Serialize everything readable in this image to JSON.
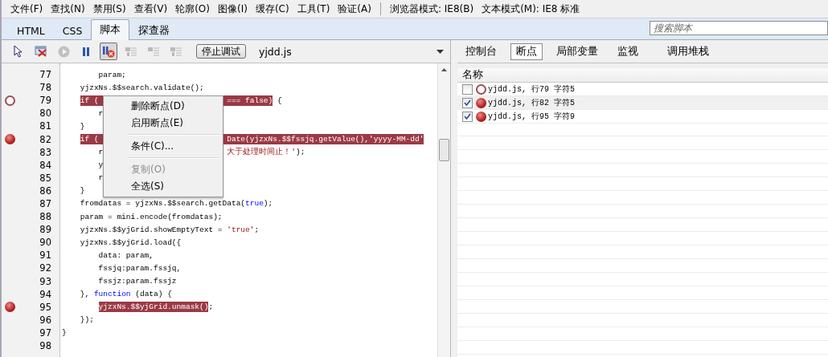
{
  "menu": [
    "文件(F)",
    "查找(N)",
    "禁用(S)",
    "查看(V)",
    "轮廓(O)",
    "图像(I)",
    "缓存(C)",
    "工具(T)",
    "验证(A)"
  ],
  "modes": [
    "浏览器模式: IE8(B)",
    "文本模式(M): IE8 标准"
  ],
  "tabs": [
    {
      "label": "HTML",
      "selected": false
    },
    {
      "label": "CSS",
      "selected": false
    },
    {
      "label": "脚本",
      "selected": true
    },
    {
      "label": "探查器",
      "selected": false
    }
  ],
  "search": {
    "placeholder": "搜索脚本"
  },
  "tools": [
    {
      "kind": "select",
      "disabled": false,
      "pressed": false
    },
    {
      "kind": "clear",
      "disabled": false,
      "pressed": false
    },
    {
      "kind": "continue",
      "disabled": true,
      "pressed": false
    },
    {
      "kind": "pause",
      "disabled": false,
      "pressed": false
    },
    {
      "kind": "break-on-error",
      "disabled": false,
      "pressed": true
    },
    {
      "kind": "step-into",
      "disabled": true,
      "pressed": false
    },
    {
      "kind": "step-over",
      "disabled": true,
      "pressed": false
    },
    {
      "kind": "step-out",
      "disabled": true,
      "pressed": false
    }
  ],
  "stop_button": "停止调试",
  "script_select": {
    "value": "yjdd.js"
  },
  "code_lines": [
    {
      "number": "77",
      "segments": [
        {
          "kind": "code",
          "text": "        param;",
          "highlight": false
        }
      ]
    },
    {
      "number": "78",
      "segments": [
        {
          "kind": "code",
          "text": "    yjzxNs.$$search.validate();",
          "highlight": false
        }
      ]
    },
    {
      "number": "79",
      "breakpoint": {
        "enabled": false
      },
      "segments": [
        {
          "kind": "code",
          "text": "    if (                            === false)",
          "highlight": true
        },
        {
          "kind": "code",
          "text": " {",
          "highlight": false
        }
      ]
    },
    {
      "number": "80",
      "segments": [
        {
          "kind": "code",
          "text": "        r",
          "highlight": false
        }
      ]
    },
    {
      "number": "81",
      "segments": [
        {
          "kind": "code",
          "text": "    }",
          "highlight": false
        }
      ]
    },
    {
      "number": "82",
      "breakpoint": {
        "enabled": true
      },
      "segments": [
        {
          "kind": "code",
          "text": "    if (                            Date(yjzxNs.$$fssjq.getValue(),'yyyy-MM-dd'",
          "highlight": true
        }
      ]
    },
    {
      "number": "83",
      "segments": [
        {
          "kind": "code",
          "text": "        r                           ",
          "highlight": false
        },
        {
          "kind": "string",
          "text": "大于处理时间止！'",
          "highlight": false
        },
        {
          "kind": "code",
          "text": ");",
          "highlight": false
        }
      ]
    },
    {
      "number": "84",
      "segments": [
        {
          "kind": "code",
          "text": "        y",
          "highlight": false
        }
      ]
    },
    {
      "number": "85",
      "segments": [
        {
          "kind": "code",
          "text": "        r",
          "highlight": false
        }
      ]
    },
    {
      "number": "86",
      "segments": [
        {
          "kind": "code",
          "text": "    }",
          "highlight": false
        }
      ]
    },
    {
      "number": "87",
      "segments": [
        {
          "kind": "code",
          "text": "    fromdatas = yjzxNs.$$search.getData(",
          "highlight": false
        },
        {
          "kind": "keyword",
          "text": "true",
          "highlight": false
        },
        {
          "kind": "code",
          "text": ");",
          "highlight": false
        }
      ]
    },
    {
      "number": "88",
      "segments": [
        {
          "kind": "code",
          "text": "    param = mini.encode(fromdatas);",
          "highlight": false
        }
      ]
    },
    {
      "number": "89",
      "segments": [
        {
          "kind": "code",
          "text": "    yjzxNs.$$yjGrid.showEmptyText = ",
          "highlight": false
        },
        {
          "kind": "string",
          "text": "'true'",
          "highlight": false
        },
        {
          "kind": "code",
          "text": ";",
          "highlight": false
        }
      ]
    },
    {
      "number": "90",
      "segments": [
        {
          "kind": "code",
          "text": "    yjzxNs.$$yjGrid.load({",
          "highlight": false
        }
      ]
    },
    {
      "number": "91",
      "segments": [
        {
          "kind": "code",
          "text": "        data: param,",
          "highlight": false
        }
      ]
    },
    {
      "number": "92",
      "segments": [
        {
          "kind": "code",
          "text": "        fssjq:param.fssjq,",
          "highlight": false
        }
      ]
    },
    {
      "number": "93",
      "segments": [
        {
          "kind": "code",
          "text": "        fssjz:param.fssjz",
          "highlight": false
        }
      ]
    },
    {
      "number": "94",
      "segments": [
        {
          "kind": "code",
          "text": "    }, ",
          "highlight": false
        },
        {
          "kind": "keyword",
          "text": "function",
          "highlight": false
        },
        {
          "kind": "code",
          "text": " (data) {",
          "highlight": false
        }
      ]
    },
    {
      "number": "95",
      "breakpoint": {
        "enabled": true
      },
      "segments": [
        {
          "kind": "code",
          "text": "        yjzxNs.$$yjGrid.unmask()",
          "highlight": true
        },
        {
          "kind": "code",
          "text": ";",
          "highlight": false
        }
      ]
    },
    {
      "number": "96",
      "segments": [
        {
          "kind": "code",
          "text": "    });",
          "highlight": false
        }
      ]
    },
    {
      "number": "97",
      "segments": [
        {
          "kind": "code",
          "text": "}",
          "highlight": false
        }
      ]
    },
    {
      "number": "98"
    }
  ],
  "context_menu": [
    {
      "kind": "item",
      "label": "删除断点(D)",
      "disabled": false
    },
    {
      "kind": "item",
      "label": "启用断点(E)",
      "disabled": false
    },
    {
      "kind": "separator"
    },
    {
      "kind": "item",
      "label": "条件(C)...",
      "disabled": false
    },
    {
      "kind": "separator"
    },
    {
      "kind": "item",
      "label": "复制(O)",
      "disabled": true
    },
    {
      "kind": "item",
      "label": "全选(S)",
      "disabled": false
    }
  ],
  "panel_tabs": [
    {
      "label": "控制台",
      "selected": false
    },
    {
      "label": "断点",
      "selected": true
    },
    {
      "label": "局部变量",
      "selected": false
    },
    {
      "label": "监视",
      "selected": false
    },
    {
      "label": "调用堆栈",
      "selected": false
    }
  ],
  "breakpoints": {
    "header": "名称",
    "rows": [
      {
        "checked": false,
        "enabled": false,
        "selected": false,
        "label": "yjdd.js, 行79 字符5"
      },
      {
        "checked": true,
        "enabled": true,
        "selected": true,
        "label": "yjdd.js, 行82 字符5"
      },
      {
        "checked": true,
        "enabled": true,
        "selected": false,
        "label": "yjdd.js, 行95 字符9"
      }
    ]
  }
}
